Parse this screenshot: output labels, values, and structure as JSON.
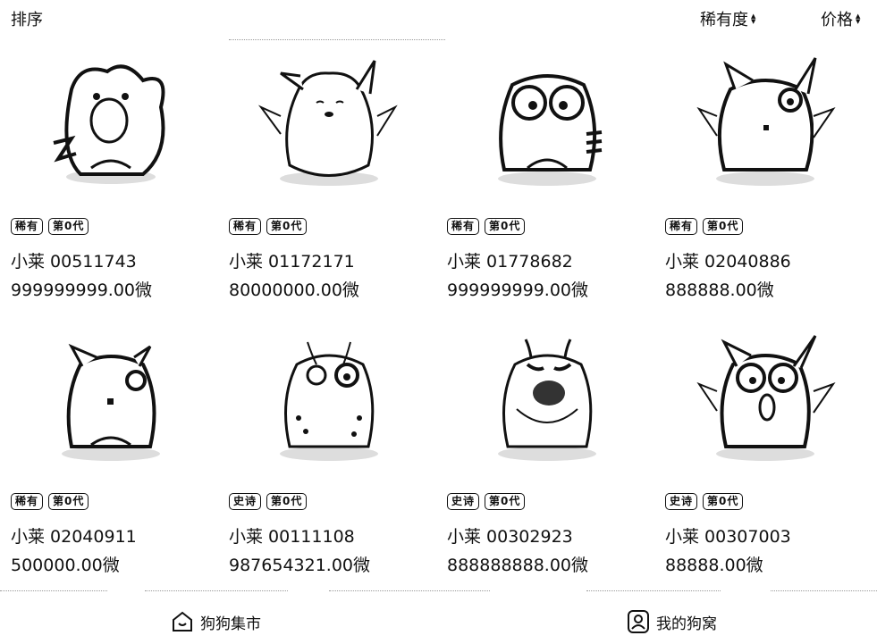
{
  "header": {
    "sort_label": "排序",
    "filters": [
      {
        "label": "稀有度",
        "icon": "sort-arrows-icon"
      },
      {
        "label": "价格",
        "icon": "sort-arrows-icon"
      }
    ]
  },
  "dogs": [
    {
      "tags": [
        "稀有",
        "第0代"
      ],
      "name": "小莱 00511743",
      "price": "999999999.00微"
    },
    {
      "tags": [
        "稀有",
        "第0代"
      ],
      "name": "小莱 01172171",
      "price": "80000000.00微"
    },
    {
      "tags": [
        "稀有",
        "第0代"
      ],
      "name": "小莱 01778682",
      "price": "999999999.00微"
    },
    {
      "tags": [
        "稀有",
        "第0代"
      ],
      "name": "小莱 02040886",
      "price": "888888.00微"
    },
    {
      "tags": [
        "稀有",
        "第0代"
      ],
      "name": "小莱 02040911",
      "price": "500000.00微"
    },
    {
      "tags": [
        "史诗",
        "第0代"
      ],
      "name": "小莱 00111108",
      "price": "987654321.00微"
    },
    {
      "tags": [
        "史诗",
        "第0代"
      ],
      "name": "小莱 00302923",
      "price": "888888888.00微"
    },
    {
      "tags": [
        "史诗",
        "第0代"
      ],
      "name": "小莱 00307003",
      "price": "88888.00微"
    }
  ],
  "bottom_nav": [
    {
      "label": "狗狗集市",
      "icon": "house-icon"
    },
    {
      "label": "我的狗窝",
      "icon": "profile-icon"
    }
  ]
}
